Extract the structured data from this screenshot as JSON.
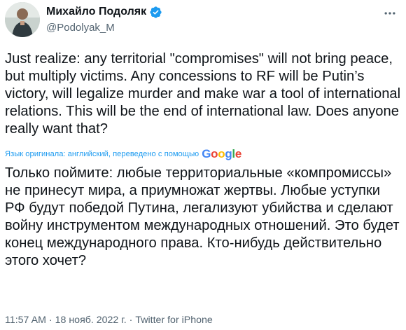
{
  "author": {
    "display_name": "Михайло Подоляк",
    "handle": "@Podolyak_M",
    "verified": true,
    "verified_color": "#1d9bf0"
  },
  "icons": {
    "verified": "verified-badge-icon",
    "more": "more-options-icon",
    "avatar": "profile-avatar"
  },
  "tweet": {
    "text": "Just realize: any territorial \"compromises\" will not bring peace, but multiply victims. Any concessions to RF will be Putin’s victory, will legalize murder and make war a tool of international relations. This will be the end of international law. Does anyone really want that?",
    "translation_label": "Язык оригинала: английский, переведено с помощью",
    "translation_provider": "Google",
    "translated_text": "Только поймите: любые территориальные «компромиссы» не принесут мира, а приумножат жертвы. Любые уступки РФ будут победой Путина, легализуют убийства и сделают войну инструментом международных отношений. Это будет конец международного права. Кто-нибудь действительно этого хочет?"
  },
  "meta": {
    "time": "11:57 AM",
    "separator": "·",
    "date": "18 нояб. 2022 г.",
    "source": "Twitter for iPhone"
  },
  "colors": {
    "text": "#0f1419",
    "secondary": "#536471",
    "accent": "#1d9bf0",
    "google_blue": "#4285f4",
    "google_red": "#ea4335",
    "google_yellow": "#fbbc05",
    "google_green": "#34a853"
  }
}
